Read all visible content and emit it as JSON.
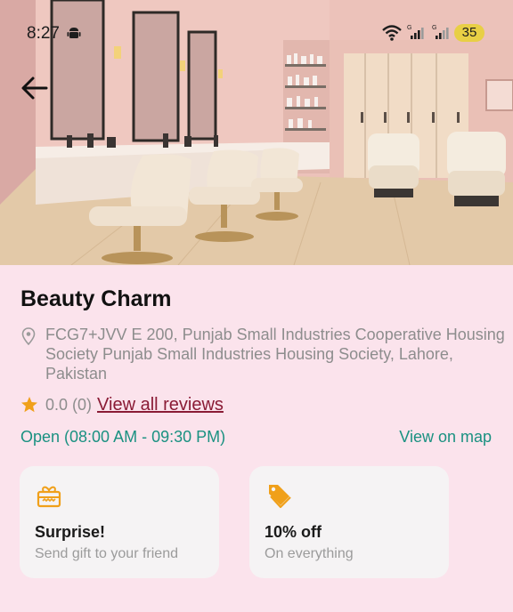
{
  "status_bar": {
    "time": "8:27",
    "battery": "35"
  },
  "salon": {
    "name": "Beauty Charm",
    "address": "FCG7+JVV E 200, Punjab Small Industries Cooperative Housing Society Punjab Small Industries Housing Society, Lahore, Pakistan",
    "rating_text": "0.0 (0)",
    "reviews_link": "View all reviews",
    "hours": "Open (08:00 AM - 09:30 PM)",
    "map_link": "View on map"
  },
  "offers": [
    {
      "icon": "gift-icon",
      "title": "Surprise!",
      "subtitle": "Send gift to your friend"
    },
    {
      "icon": "tag-icon",
      "title": "10% off",
      "subtitle": "On everything"
    }
  ],
  "colors": {
    "background": "#fbe3ec",
    "accent_teal": "#1a9181",
    "link_maroon": "#8a1b35",
    "icon_orange": "#f0a01a",
    "card_bg": "#f5f3f4"
  }
}
